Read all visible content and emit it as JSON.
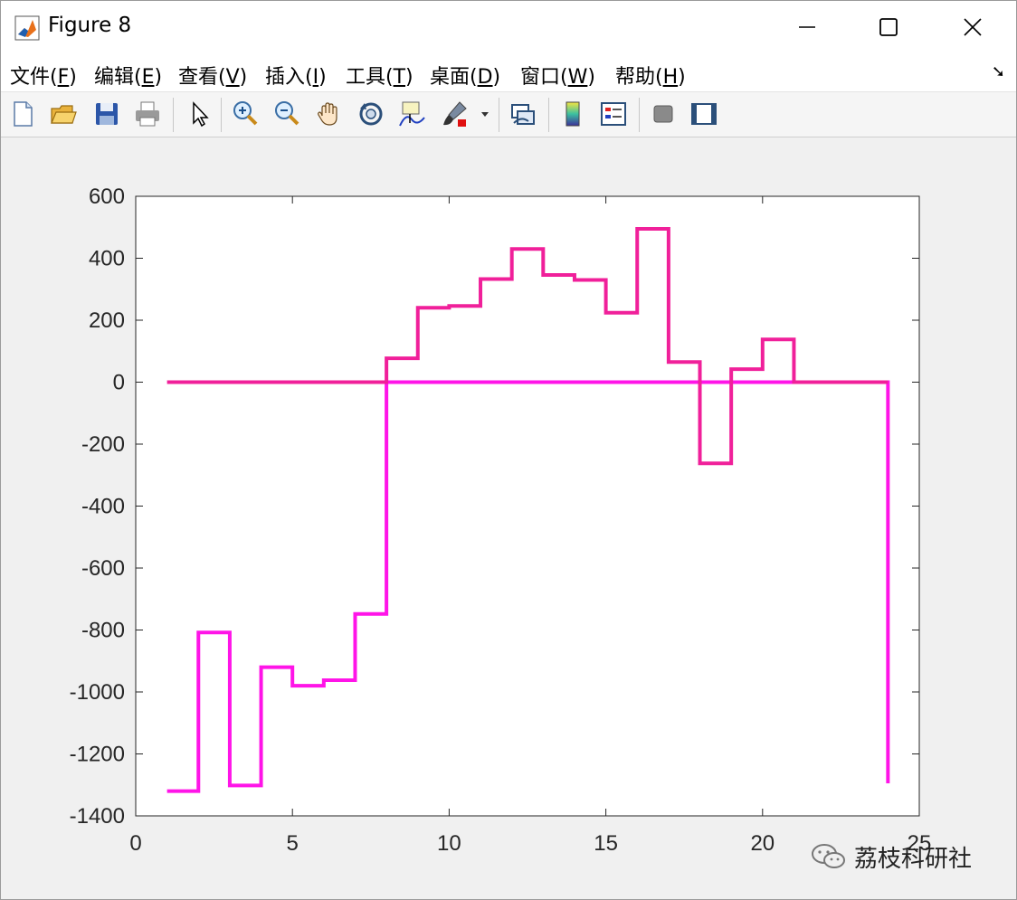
{
  "window": {
    "title": "Figure 8"
  },
  "menu": [
    {
      "label": "文件(",
      "mnemonic": "F",
      "tail": ")"
    },
    {
      "label": "编辑(",
      "mnemonic": "E",
      "tail": ")"
    },
    {
      "label": "查看(",
      "mnemonic": "V",
      "tail": ")"
    },
    {
      "label": "插入(",
      "mnemonic": "I",
      "tail": ")"
    },
    {
      "label": "工具(",
      "mnemonic": "T",
      "tail": ")"
    },
    {
      "label": "桌面(",
      "mnemonic": "D",
      "tail": ")"
    },
    {
      "label": "窗口(",
      "mnemonic": "W",
      "tail": ")"
    },
    {
      "label": "帮助(",
      "mnemonic": "H",
      "tail": ")"
    }
  ],
  "toolbar": {
    "icons": [
      "new-figure-icon",
      "open-icon",
      "save-icon",
      "print-icon",
      "pointer-icon",
      "zoom-in-icon",
      "zoom-out-icon",
      "pan-icon",
      "rotate-3d-icon",
      "data-cursor-icon",
      "brush-icon",
      "link-plot-icon",
      "colorbar-icon",
      "legend-icon",
      "hide-plot-tools-icon",
      "show-plot-tools-icon"
    ]
  },
  "watermark": {
    "text": "荔枝科研社"
  },
  "chart_data": {
    "type": "line",
    "plot_style": "stairs",
    "title": "",
    "xlabel": "",
    "ylabel": "",
    "xlim": [
      0,
      25
    ],
    "ylim": [
      -1400,
      600
    ],
    "xticks": [
      "0",
      "5",
      "10",
      "15",
      "20",
      "25"
    ],
    "yticks": [
      "600",
      "400",
      "200",
      "0",
      "-200",
      "-400",
      "-600",
      "-800",
      "-1000",
      "-1200",
      "-1400"
    ],
    "grid": false,
    "series": [
      {
        "color": "#ff14e8",
        "x": [
          1,
          2,
          3,
          4,
          5,
          6,
          7,
          8,
          9,
          10,
          11,
          12,
          13,
          14,
          15,
          16,
          17,
          18,
          19,
          20,
          21,
          22,
          23,
          24
        ],
        "y": [
          -1320,
          -808,
          -1302,
          -920,
          -980,
          -962,
          -748,
          0,
          0,
          0,
          0,
          0,
          0,
          0,
          0,
          0,
          0,
          0,
          0,
          0,
          0,
          0,
          0,
          -1295
        ]
      },
      {
        "color": "#f0209a",
        "x": [
          1,
          2,
          3,
          4,
          5,
          6,
          7,
          8,
          9,
          10,
          11,
          12,
          13,
          14,
          15,
          16,
          17,
          18,
          19,
          20,
          21,
          22,
          23,
          24
        ],
        "y": [
          0,
          0,
          0,
          0,
          0,
          0,
          0,
          77,
          240,
          246,
          333,
          430,
          346,
          330,
          224,
          495,
          65,
          -262,
          42,
          138,
          0,
          0,
          0,
          0
        ]
      }
    ]
  }
}
